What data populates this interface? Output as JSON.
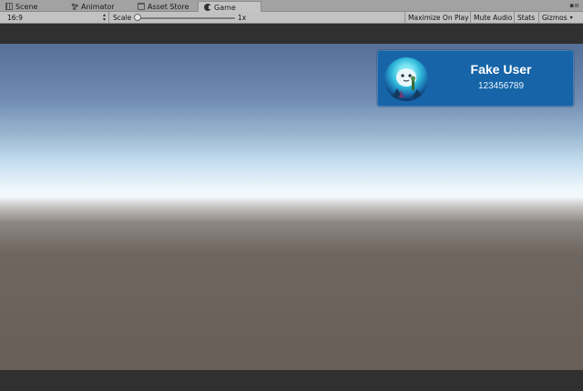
{
  "tabs": [
    {
      "label": "Scene",
      "icon": "scene-icon",
      "active": false
    },
    {
      "label": "Animator",
      "icon": "animator-icon",
      "active": false
    },
    {
      "label": "Asset Store",
      "icon": "asset-store-icon",
      "active": false
    },
    {
      "label": "Game",
      "icon": "game-icon",
      "active": true
    }
  ],
  "window_controls": "▪≡",
  "toolbar": {
    "aspect": "16:9",
    "scale_label": "Scale",
    "scale_value": "1x",
    "scale_level": 0.0,
    "maximize_on_play": "Maximize On Play",
    "mute_audio": "Mute Audio",
    "stats": "Stats",
    "gizmos": "Gizmos",
    "gizmos_arrow": "▾"
  },
  "user_card": {
    "name": "Fake User",
    "id": "123456789",
    "avatar_icon": "user-avatar-icon",
    "card_color": "#1765a8"
  },
  "colors": {
    "sky_top": "#566f98",
    "horizon": "#f2f8fb",
    "ground": "#6b625c",
    "letterbox": "#303030"
  }
}
